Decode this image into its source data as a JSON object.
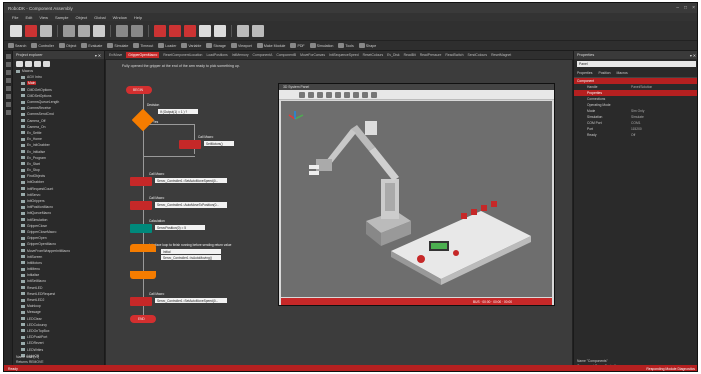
{
  "app": {
    "title": "RoboDK - Component Assembly",
    "window_controls": [
      "–",
      "□",
      "×"
    ]
  },
  "menu": [
    "File",
    "Edit",
    "View",
    "Sample",
    "Object",
    "Global",
    "Window",
    "Help"
  ],
  "toolbar2": [
    "Search",
    "Controller",
    "Object",
    "Evaluate",
    "Simulate",
    "Timeout",
    "Loader",
    "Variable",
    "Storage",
    "Viewport",
    "Make Module",
    "PDF",
    "Simulation",
    "Tools",
    "Shape"
  ],
  "explorer": {
    "title": "Project explorer",
    "root": "Macros",
    "items": [
      "AGV Intro",
      "Main",
      "CMDGetOptions",
      "CMDSetOptions",
      "CommsQueueLength",
      "CommsReceive",
      "CommsSendCmd",
      "Camera_Off",
      "Camera_On",
      "Ev_Settle",
      "Ev_Home",
      "Ev_InitGrabber",
      "Ev_Initialise",
      "Ev_Program",
      "Ev_Start",
      "Ev_Stop",
      "FindObjects",
      "InitGrabber",
      "InitRequestCount",
      "InitServo",
      "InitGrippers",
      "InitPositionMacro",
      "InitQueueMacro",
      "InitSimulation",
      "GripperClose",
      "GripperCloseMacro",
      "GripperOpen",
      "GripperOpenMacro",
      "MoveFromWrapperInitMacro",
      "InitScreen",
      "InitMotors",
      "InitMenu",
      "Initialise",
      "InitSetMacro",
      "ResetLED",
      "ResetLEDRequest",
      "ResetLED2",
      "Mainloop",
      "Message",
      "LEDClear",
      "LEDColourcy",
      "LEDOnTopBox",
      "LEDPositPort",
      "LEDRevert",
      "LEDWrites",
      "LightOff",
      "LightOn",
      "LEDWrite",
      "ResetStartupStat",
      "MoveMode",
      "Menu",
      "Motor"
    ],
    "footer": [
      "Name    Main(x1)",
      "Returns  REMOVE"
    ]
  },
  "doc_tabs": [
    "Ev/Move",
    "GripperOpenMacro",
    "ResetComponentLocation",
    "LoadPositions",
    "InitMemory",
    "ComponentA",
    "ComponentB",
    "MoveForCanvas",
    "InitSequenceSpeed",
    "ResetColours",
    "Ev_Disk",
    "ReadBit",
    "ReadPressure",
    "ReadSwitch",
    "SendColours",
    "ResetMagnet"
  ],
  "flowchart": {
    "note": "Fully opened the gripper at the end of the arm ready to pick something up.",
    "begin": "BEGIN",
    "end": "END",
    "decision_label": "Decision",
    "decision_expr": "If (Output(1) = 1 ) ?",
    "decision_yes": "Yes",
    "calls": [
      {
        "label": "Call Macro",
        "value": "SetMotors()"
      },
      {
        "label": "Call Macro",
        "value": "Servo_Controller1::SetAutoMoveSpeed(0..."
      },
      {
        "label": "Call Macro",
        "value": "Servo_Controller1::AutoMoveToPosition(0..."
      },
      {
        "label": "Calculation",
        "value": "ServoPosition(0) = 5"
      },
      {
        "label": "Call Macro",
        "value": "Servo_Controller1::SetAutoMoveSpeed(0..."
      }
    ],
    "loop_label": "Interface loop to finish running before sending return value",
    "loop_values": [
      "Initial",
      "Servo_Controller1::IsAutoMoving()"
    ]
  },
  "sim": {
    "title": "3D System Panel",
    "status": "BUS · 00:00 · 00:00 · 00:00"
  },
  "props": {
    "title": "Properties",
    "search": "Panel",
    "tabs": [
      "Properties",
      "Position",
      "Macros"
    ],
    "section": "Component",
    "rows": [
      {
        "k": "Handle",
        "v": "Panel/Solution"
      },
      {
        "k": "Properties",
        "v": "",
        "red": true
      },
      {
        "k": "Connections",
        "v": ""
      },
      {
        "k": "Operating Mode",
        "v": ""
      },
      {
        "k": "Mode",
        "v": "Sim Only"
      },
      {
        "k": "Simulation",
        "v": "Simulate"
      },
      {
        "k": "COM Port",
        "v": "COM1"
      },
      {
        "k": "Port",
        "v": "115200"
      },
      {
        "k": "Ready",
        "v": "Off"
      }
    ],
    "footer": [
      "Name        \"Components\"",
      "Component   Servo Controller"
    ]
  },
  "status": {
    "left": "Ready",
    "right": "Responding Module   Diagnostics"
  }
}
